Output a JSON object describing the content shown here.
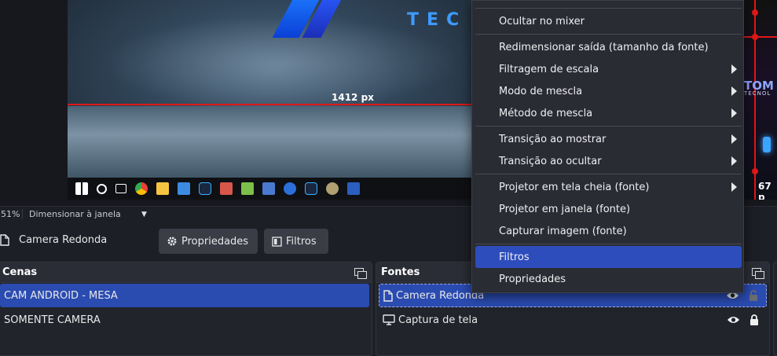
{
  "preview": {
    "brand_text": "TEC",
    "measure_label": "1412 px",
    "right_measure_label": "67 p",
    "right_logo_title": "TOM",
    "right_logo_sub": "TECNOL"
  },
  "taskbar": {
    "icons": [
      "windows-icon",
      "search-icon",
      "task-view-icon",
      "chrome-icon",
      "file-explorer-icon",
      "app-icon-1",
      "app-icon-2",
      "app-icon-3",
      "app-icon-4",
      "app-icon-5",
      "app-icon-6",
      "app-icon-7",
      "app-icon-8",
      "app-icon-9"
    ]
  },
  "statusbar": {
    "zoom": "51%",
    "scale_mode": "Dimensionar à janela"
  },
  "toolbar": {
    "source_name": "Camera Redonda",
    "properties_label": "Propriedades",
    "filters_label": "Filtros"
  },
  "scenes": {
    "title": "Cenas",
    "items": [
      {
        "label": "CAM ANDROID - MESA",
        "selected": true
      },
      {
        "label": "SOMENTE CAMERA",
        "selected": false
      }
    ]
  },
  "sources": {
    "title": "Fontes",
    "items": [
      {
        "label": "Camera Redonda",
        "icon": "file-icon",
        "selected": true
      },
      {
        "label": "Captura de tela",
        "icon": "monitor-icon",
        "selected": false
      }
    ]
  },
  "context_menu": {
    "items": [
      {
        "label": "Ocultar no mixer",
        "submenu": false
      },
      {
        "label": "Redimensionar saída (tamanho da fonte)",
        "submenu": false
      },
      {
        "label": "Filtragem de escala",
        "submenu": true
      },
      {
        "label": "Modo de mescla",
        "submenu": true
      },
      {
        "label": "Método de mescla",
        "submenu": true
      },
      {
        "label": "Transição ao mostrar",
        "submenu": true
      },
      {
        "label": "Transição ao ocultar",
        "submenu": true
      },
      {
        "label": "Projetor em tela cheia (fonte)",
        "submenu": true
      },
      {
        "label": "Projetor em janela (fonte)",
        "submenu": false
      },
      {
        "label": "Capturar imagem (fonte)",
        "submenu": false
      },
      {
        "label": "Filtros",
        "submenu": false,
        "highlighted": true
      },
      {
        "label": "Propriedades",
        "submenu": false
      }
    ]
  },
  "colors": {
    "accent": "#2a4bb0",
    "menu_highlight": "#2e4dbd",
    "guide_line": "#e01818"
  }
}
